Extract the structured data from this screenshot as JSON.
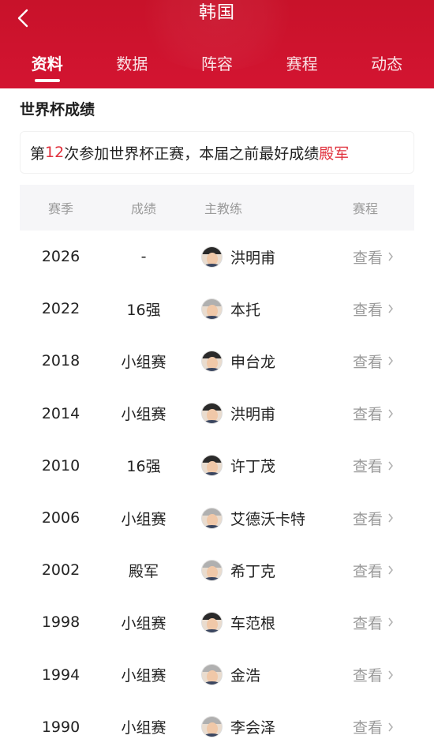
{
  "header": {
    "title": "韩国",
    "tabs": [
      {
        "label": "资料",
        "active": true
      },
      {
        "label": "数据",
        "active": false
      },
      {
        "label": "阵容",
        "active": false
      },
      {
        "label": "赛程",
        "active": false
      },
      {
        "label": "动态",
        "active": false
      }
    ]
  },
  "section": {
    "title": "世界杯成绩",
    "summary_prefix": "第",
    "summary_count": "12",
    "summary_mid": "次参加世界杯正赛，本届之前最好成绩",
    "summary_best": "殿军"
  },
  "table": {
    "headers": {
      "season": "赛季",
      "result": "成绩",
      "coach": "主教练",
      "schedule": "赛程"
    },
    "view_label": "查看",
    "rows": [
      {
        "season": "2026",
        "result": "-",
        "coach": "洪明甫",
        "avatar": "coach-avatar-icon"
      },
      {
        "season": "2022",
        "result": "16强",
        "coach": "本托",
        "avatar": "coach-avatar-icon"
      },
      {
        "season": "2018",
        "result": "小组赛",
        "coach": "申台龙",
        "avatar": "coach-avatar-icon"
      },
      {
        "season": "2014",
        "result": "小组赛",
        "coach": "洪明甫",
        "avatar": "coach-avatar-icon"
      },
      {
        "season": "2010",
        "result": "16强",
        "coach": "许丁茂",
        "avatar": "coach-avatar-icon"
      },
      {
        "season": "2006",
        "result": "小组赛",
        "coach": "艾德沃卡特",
        "avatar": "coach-avatar-icon"
      },
      {
        "season": "2002",
        "result": "殿军",
        "coach": "希丁克",
        "avatar": "coach-avatar-icon"
      },
      {
        "season": "1998",
        "result": "小组赛",
        "coach": "车范根",
        "avatar": "coach-avatar-icon"
      },
      {
        "season": "1994",
        "result": "小组赛",
        "coach": "金浩",
        "avatar": "coach-avatar-icon"
      },
      {
        "season": "1990",
        "result": "小组赛",
        "coach": "李会泽",
        "avatar": "coach-avatar-icon"
      }
    ]
  },
  "colors": {
    "brand": "#d31431",
    "highlight": "#e0303c",
    "muted": "#9a9a9a"
  }
}
